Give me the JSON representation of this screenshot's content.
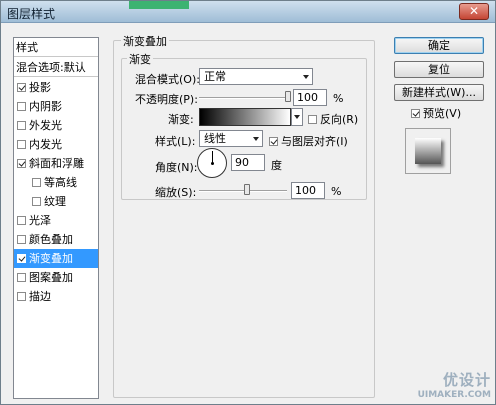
{
  "window": {
    "title": "图层样式",
    "close_glyph": "✕"
  },
  "style_list": {
    "header": "样式",
    "blend_default": "混合选项:默认",
    "items": [
      {
        "label": "投影",
        "checked": true
      },
      {
        "label": "内阴影",
        "checked": false
      },
      {
        "label": "外发光",
        "checked": false
      },
      {
        "label": "内发光",
        "checked": false
      },
      {
        "label": "斜面和浮雕",
        "checked": true
      },
      {
        "label": "等高线",
        "checked": false
      },
      {
        "label": "纹理",
        "checked": false
      },
      {
        "label": "光泽",
        "checked": false
      },
      {
        "label": "颜色叠加",
        "checked": false
      },
      {
        "label": "渐变叠加",
        "checked": true,
        "selected": true
      },
      {
        "label": "图案叠加",
        "checked": false
      },
      {
        "label": "描边",
        "checked": false
      }
    ]
  },
  "panel": {
    "outer_group": "渐变叠加",
    "inner_group": "渐变",
    "blend_mode_label": "混合模式(O):",
    "blend_mode_value": "正常",
    "opacity_label": "不透明度(P):",
    "opacity_value": "100",
    "opacity_unit": "%",
    "opacity_level": 100,
    "gradient_label": "渐变:",
    "reverse_label": "反向(R)",
    "reverse_checked": false,
    "style_label": "样式(L):",
    "style_value": "线性",
    "align_label": "与图层对齐(I)",
    "align_checked": true,
    "angle_label": "角度(N):",
    "angle_value": "90",
    "angle_unit": "度",
    "scale_label": "缩放(S):",
    "scale_value": "100",
    "scale_unit": "%",
    "scale_level_fraction": 0.55
  },
  "buttons": {
    "ok": "确定",
    "reset": "复位",
    "new_style": "新建样式(W)...",
    "preview_label": "预览(V)",
    "preview_checked": true
  },
  "watermark": {
    "line1": "优设计",
    "line2": "UIMAKER.COM"
  },
  "colors": {
    "selection": "#3399ff",
    "title_gradient_top": "#cfe0ee",
    "close_red": "#c44534"
  }
}
